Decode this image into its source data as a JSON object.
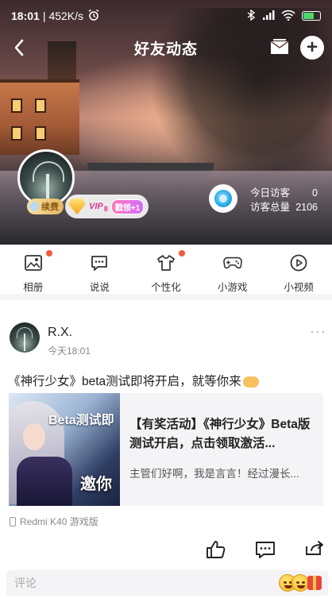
{
  "status_bar": {
    "time": "18:01",
    "speed": "452K/s",
    "battery_level": 0.6
  },
  "header": {
    "title": "好友动态",
    "back_icon": "chevron-left-icon",
    "mail_icon": "envelope-icon",
    "add_icon": "plus-icon"
  },
  "profile": {
    "badge_renew": "续费",
    "vip_text": "VIP",
    "vip_level": "8",
    "vip_pill": "戳领+1",
    "visitors": {
      "today_label": "今日访客",
      "today_value": "0",
      "total_label": "访客总量",
      "total_value": "2106"
    }
  },
  "nav": {
    "items": [
      {
        "label": "相册",
        "icon": "photo-album-icon",
        "has_dot": true
      },
      {
        "label": "说说",
        "icon": "speech-bubble-icon",
        "has_dot": false
      },
      {
        "label": "个性化",
        "icon": "tshirt-icon",
        "has_dot": true
      },
      {
        "label": "小游戏",
        "icon": "gamepad-icon",
        "has_dot": false
      },
      {
        "label": "小视频",
        "icon": "play-circle-icon",
        "has_dot": false
      }
    ]
  },
  "post": {
    "author": "R.X.",
    "time": "今天18:01",
    "text": "《神行少女》beta测试即将开启，就等你来",
    "share": {
      "thumb_beta": "Beta测试即",
      "thumb_invite": "邀你",
      "title": "【有奖活动】《神行少女》Beta版测试开启，点击领取激活...",
      "desc": "主管们好啊，我是言言！经过漫长..."
    },
    "device": "Redmi K40 游戏版"
  },
  "comment": {
    "placeholder": "评论"
  },
  "colors": {
    "accent_dot": "#f35a3c",
    "vip_pink": "#d63b8f",
    "divider": "#f3f4f6"
  }
}
